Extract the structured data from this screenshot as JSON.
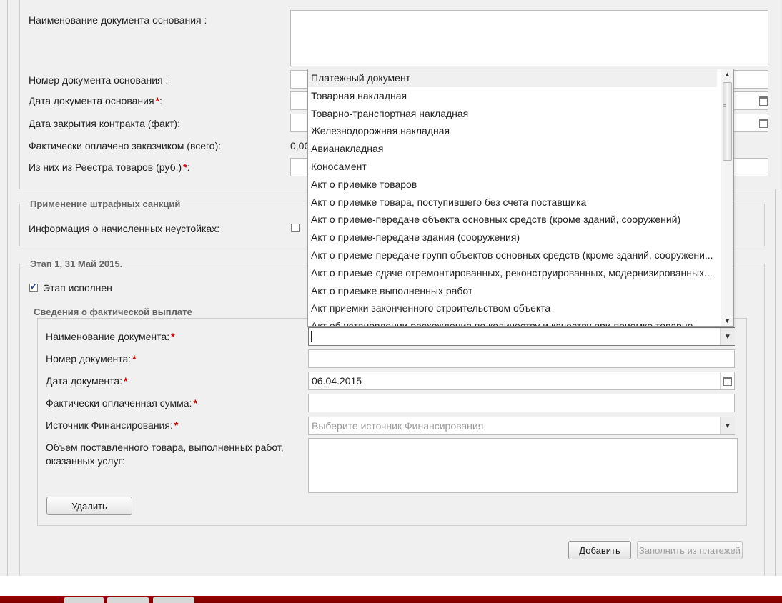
{
  "contract": {
    "labels": {
      "basis_doc_name": "Наименование документа основания :",
      "basis_doc_number": "Номер документа основания :",
      "basis_doc_date": "Дата документа основания",
      "close_date_fact": "Дата закрытия контракта (факт):",
      "paid_total": "Фактически оплачено заказчиком (всего):",
      "registry_goods": "Из них из Реестра товаров (руб.)"
    },
    "paid_total_value": "0,00",
    "required_mark": "*",
    "colon": ":"
  },
  "penalties": {
    "legend": "Применение штрафных санкций",
    "info_label": "Информация о начисленных неустойках:",
    "checked": false
  },
  "stage": {
    "legend": "Этап 1, 31 Май 2015.",
    "done_label": "Этап исполнен",
    "done_checked": true,
    "payment": {
      "legend": "Сведения о фактической выплате",
      "labels": {
        "doc_name": "Наименование документа:",
        "doc_number": "Номер документа:",
        "doc_date": "Дата документа:",
        "paid_sum": "Фактически оплаченная сумма:",
        "funding_source": "Источник Финансирования:",
        "volume": "Объем поставленного товара, выполненных работ, оказанных услуг:"
      },
      "doc_name_value": "",
      "doc_date_value": "06.04.2015",
      "funding_placeholder": "Выберите источник Финансирования",
      "delete_label": "Удалить"
    }
  },
  "buttons": {
    "add": "Добавить",
    "fill_from_payments": "Заполнить из платежей"
  },
  "dropdown": {
    "items": [
      "Платежный документ",
      "Товарная накладная",
      "Товарно-транспортная накладная",
      "Железнодорожная накладная",
      "Авианакладная",
      "Коносамент",
      "Акт о приемке товаров",
      "Акт о приемке товара, поступившего без счета поставщика",
      "Акт о приеме-передаче объекта основных средств (кроме зданий, сооружений)",
      "Акт о приеме-передаче здания (сооружения)",
      "Акт о приеме-передаче групп объектов основных средств (кроме зданий, сооружени...",
      "Акт о приеме-сдаче отремонтированных, реконструированных, модернизированных...",
      "Акт о приемке выполненных работ",
      "Акт приемки законченного строительством объекта",
      "Акт об установлении расхождения по количеству и качеству при приемке товарно..."
    ],
    "hover_index": 0
  }
}
